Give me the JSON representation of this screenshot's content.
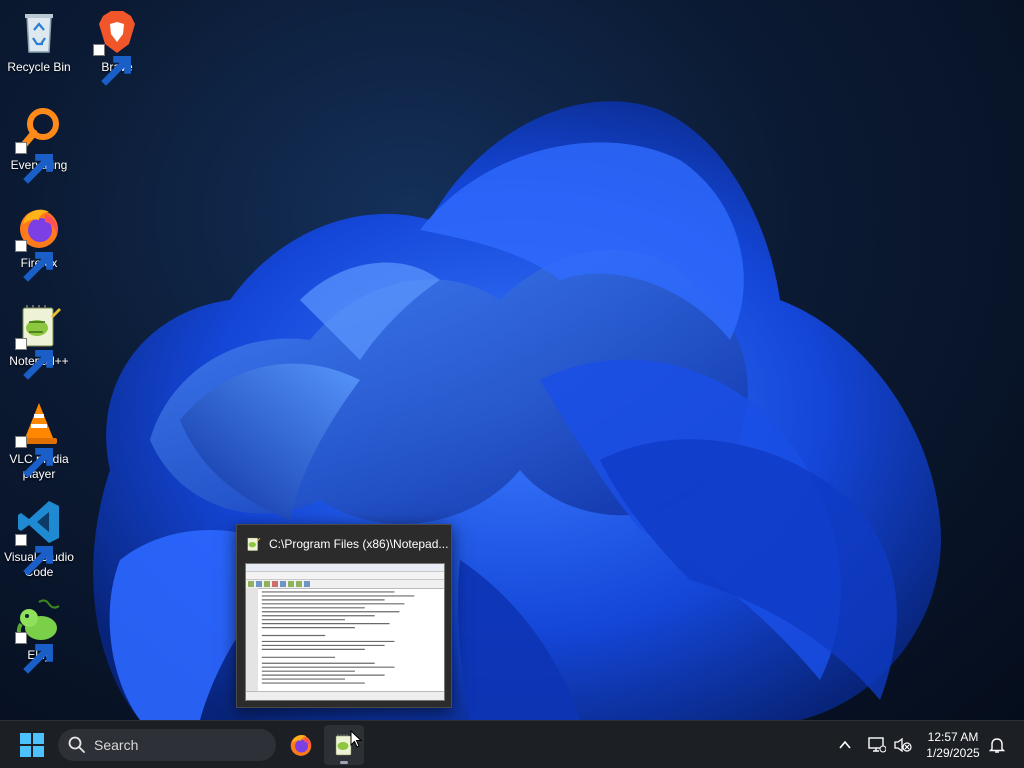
{
  "desktop": {
    "icons": [
      {
        "label": "Recycle Bin",
        "icon": "recycle-bin-icon"
      },
      {
        "label": "Brave",
        "icon": "brave-icon",
        "shortcut": true
      },
      {
        "label": "Everything",
        "icon": "everything-icon",
        "shortcut": true
      },
      {
        "label": "Firefox",
        "icon": "firefox-icon",
        "shortcut": true
      },
      {
        "label": "Notepad++",
        "icon": "notepad-plus-plus-icon",
        "shortcut": true
      },
      {
        "label": "VLC media player",
        "icon": "vlc-icon",
        "shortcut": true
      },
      {
        "label": "Visual Studio Code",
        "icon": "vscode-icon",
        "shortcut": true
      },
      {
        "label": "Eldy",
        "icon": "eldy-icon",
        "shortcut": true
      }
    ],
    "wallpaper_accent": "#1f5fff"
  },
  "preview": {
    "title": "C:\\Program Files (x86)\\Notepad...",
    "icon": "notepad-plus-plus-icon"
  },
  "taskbar": {
    "search_placeholder": "Search",
    "pinned": [
      {
        "name": "Firefox",
        "icon": "firefox-icon"
      },
      {
        "name": "Notepad++",
        "icon": "notepad-plus-plus-icon",
        "active": true
      }
    ],
    "tray": {
      "time": "12:57 AM",
      "date": "1/29/2025",
      "icons": [
        "chevron-up-icon",
        "network-icon",
        "volume-muted-icon",
        "notification-bell-icon"
      ]
    }
  }
}
